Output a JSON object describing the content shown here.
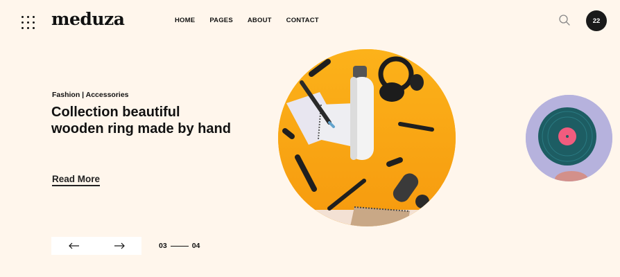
{
  "header": {
    "logo": "meduza",
    "nav": [
      "HOME",
      "PAGES",
      "ABOUT",
      "CONTACT"
    ],
    "cart_count": "22"
  },
  "hero": {
    "category": "Fashion | Accessories",
    "headline": "Collection beautiful wooden ring made by hand",
    "read_more": "Read More",
    "pager_current": "03",
    "pager_total": "04"
  },
  "colors": {
    "background": "#fff6ec",
    "hero_image_bg": "#fbae17",
    "side_image_bg": "#b7b2dd",
    "dark": "#1a1a1a"
  }
}
